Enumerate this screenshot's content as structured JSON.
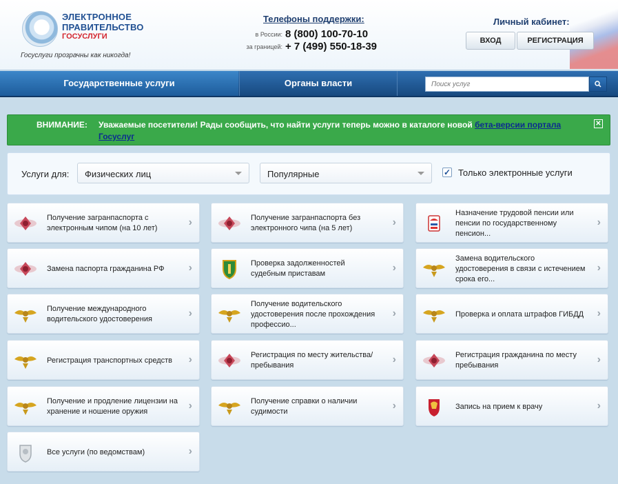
{
  "header": {
    "logo_line1": "ЭЛЕКТРОННОЕ",
    "logo_line2": "ПРАВИТЕЛЬСТВО",
    "logo_line3": "ГОСУСЛУГИ",
    "slogan": "Госуслуги прозрачны как никогда!",
    "phones_title": "Телефоны поддержки:",
    "phones": [
      {
        "label": "в России:",
        "number": "8 (800) 100-70-10"
      },
      {
        "label": "за границей:",
        "number": "+ 7 (499) 550-18-39"
      }
    ],
    "cabinet_title": "Личный кабинет:",
    "login_label": "ВХОД",
    "register_label": "РЕГИСТРАЦИЯ"
  },
  "nav": {
    "tabs": [
      {
        "label": "Государственные услуги"
      },
      {
        "label": "Органы власти"
      }
    ],
    "search_placeholder": "Поиск услуг"
  },
  "alert": {
    "heading": "ВНИМАНИЕ:",
    "text": "Уважаемые посетители! Рады сообщить, что найти услуги теперь можно в каталоге новой",
    "link_text": "бета-версии портала Госуслуг",
    "close_symbol": "✕"
  },
  "filter": {
    "label": "Услуги для:",
    "audience_value": "Физических лиц",
    "sort_value": "Популярные",
    "only_electronic_label": "Только электронные услуги",
    "only_electronic_checked": true
  },
  "services": [
    {
      "label": "Получение загранпаспорта с электронным чипом (на 10 лет)",
      "icon": "passport-emblem-icon"
    },
    {
      "label": "Получение загранпаспорта без электронного чипа (на 5 лет)",
      "icon": "passport-emblem-icon"
    },
    {
      "label": "Назначение трудовой пенсии или пенсии по государственному пенсион...",
      "icon": "pension-fund-icon"
    },
    {
      "label": "Замена паспорта гражданина РФ",
      "icon": "passport-emblem-icon"
    },
    {
      "label": "Проверка задолженностей судебным приставам",
      "icon": "bailiffs-emblem-icon"
    },
    {
      "label": "Замена водительского удостоверения в связи с истечением срока его...",
      "icon": "mvd-eagle-icon"
    },
    {
      "label": "Получение международного водительского удостоверения",
      "icon": "mvd-eagle-icon"
    },
    {
      "label": "Получение водительского удостоверения после прохождения профессио...",
      "icon": "mvd-eagle-icon"
    },
    {
      "label": "Проверка и оплата штрафов ГИБДД",
      "icon": "mvd-eagle-icon"
    },
    {
      "label": "Регистрация транспортных средств",
      "icon": "mvd-eagle-icon"
    },
    {
      "label": "Регистрация по месту жительства/пребывания",
      "icon": "passport-emblem-icon"
    },
    {
      "label": "Регистрация гражданина по месту пребывания",
      "icon": "passport-emblem-icon"
    },
    {
      "label": "Получение и продление лицензии на хранение и ношение оружия",
      "icon": "mvd-eagle-icon"
    },
    {
      "label": "Получение справки о наличии судимости",
      "icon": "mvd-eagle-icon"
    },
    {
      "label": "Запись на прием к врачу",
      "icon": "coat-of-arms-icon"
    },
    {
      "label": "Все услуги (по ведомствам)",
      "icon": "grey-emblem-icon"
    }
  ],
  "colors": {
    "nav_blue": "#1d5c9b",
    "alert_green": "#3aa94a",
    "link_blue": "#0c2c8e",
    "brand_red": "#d4242c"
  }
}
